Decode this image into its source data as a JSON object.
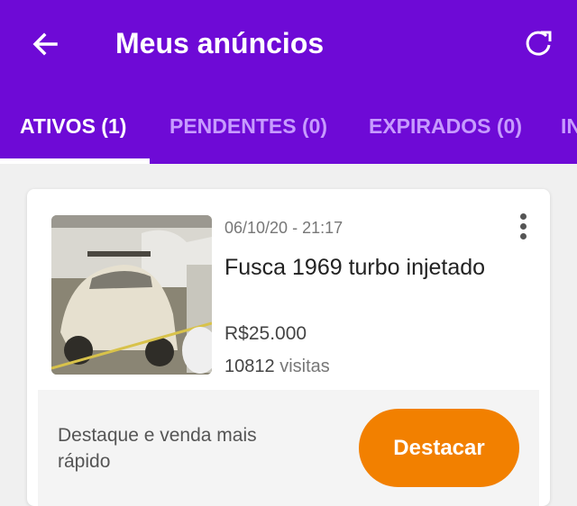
{
  "header": {
    "title": "Meus anúncios",
    "back_icon": "arrow-left-icon",
    "refresh_icon": "refresh-icon"
  },
  "tabs": [
    {
      "label": "ATIVOS (1)",
      "active": true
    },
    {
      "label": "PENDENTES (0)",
      "active": false
    },
    {
      "label": "EXPIRADOS (0)",
      "active": false
    },
    {
      "label": "IN",
      "active": false
    }
  ],
  "listing": {
    "date": "06/10/20 - 21:17",
    "title": "Fusca 1969 turbo injetado",
    "price": "R$25.000",
    "visits_count": "10812",
    "visits_label": "visitas",
    "menu_icon": "more-vertical-icon"
  },
  "promo": {
    "text": "Destaque e venda mais rápido",
    "button_label": "Destacar"
  },
  "colors": {
    "appbar": "#6e0ad6",
    "tab_inactive": "#c79bff",
    "cta": "#f28000"
  }
}
